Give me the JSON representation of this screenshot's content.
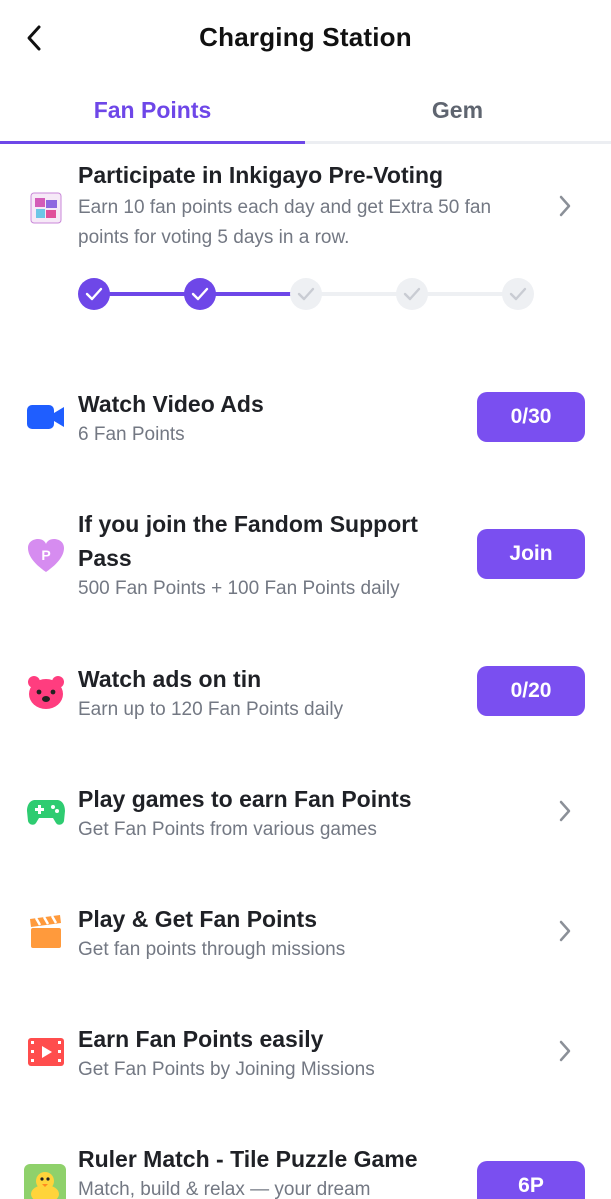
{
  "header": {
    "title": "Charging Station",
    "back_icon": "chevron-left-icon"
  },
  "tabs": [
    {
      "label": "Fan Points",
      "active": true
    },
    {
      "label": "Gem",
      "active": false
    }
  ],
  "colors": {
    "accent": "#6e47e8",
    "button": "#7a4ff0",
    "muted": "#737883"
  },
  "voting": {
    "title": "Participate in Inkigayo Pre-Voting",
    "subtitle_line1": "Earn 10 fan points each day and get Extra 50 fan",
    "subtitle_line2": "points for voting 5 days in a row.",
    "icon": "inkigayo-logo-icon",
    "days_total": 5,
    "days_completed": 2
  },
  "missions": [
    {
      "title": "Watch Video Ads",
      "subtitle": "6 Fan Points",
      "icon": "video-camera-icon",
      "button": "0/30"
    },
    {
      "title_line1": "If you join the Fandom Support",
      "title_line2": "Pass",
      "subtitle": "500 Fan Points + 100 Fan Points daily",
      "icon": "heart-pass-icon",
      "button": "Join"
    },
    {
      "title": "Watch ads on tin",
      "subtitle": "Earn up to 120 Fan Points daily",
      "icon": "bear-icon",
      "button": "0/20"
    },
    {
      "title": "Play games to earn Fan Points",
      "subtitle": "Get Fan Points from various games",
      "icon": "gamepad-icon"
    },
    {
      "title": "Play & Get Fan Points",
      "subtitle": "Get fan points through missions",
      "icon": "clapperboard-icon"
    },
    {
      "title": "Earn Fan Points easily",
      "subtitle": "Get Fan Points by Joining Missions",
      "icon": "video-play-icon"
    },
    {
      "title": "Ruler Match - Tile Puzzle Game",
      "subtitle": "Match, build & relax — your dream",
      "icon": "duck-game-icon",
      "button": "6P"
    }
  ]
}
